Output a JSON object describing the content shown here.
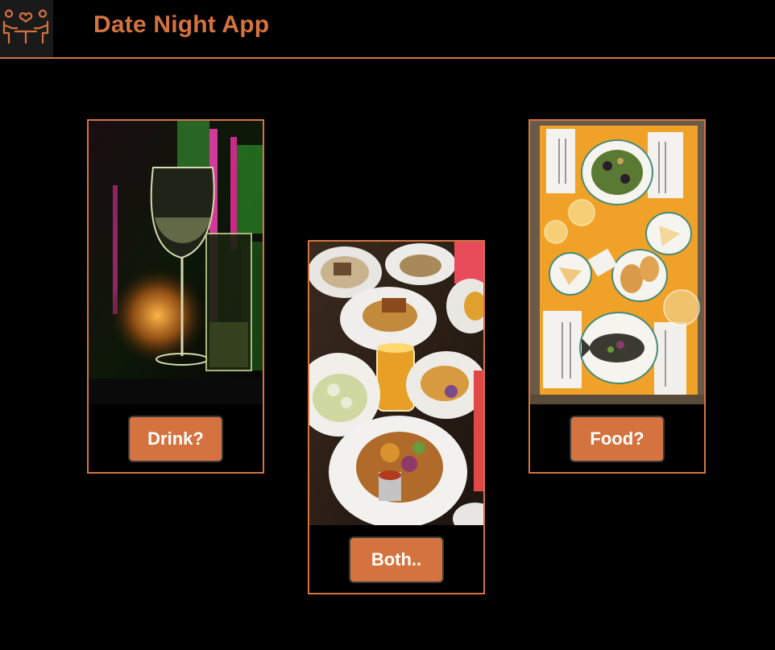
{
  "app": {
    "title": "Date Night App"
  },
  "cards": [
    {
      "id": "drink",
      "button_label": "Drink?"
    },
    {
      "id": "both",
      "button_label": "Both.."
    },
    {
      "id": "food",
      "button_label": "Food?"
    }
  ],
  "colors": {
    "accent": "#d4733f",
    "background": "#000000",
    "button_text": "#ffffff"
  },
  "icons": {
    "logo": "couple-dining-icon"
  }
}
